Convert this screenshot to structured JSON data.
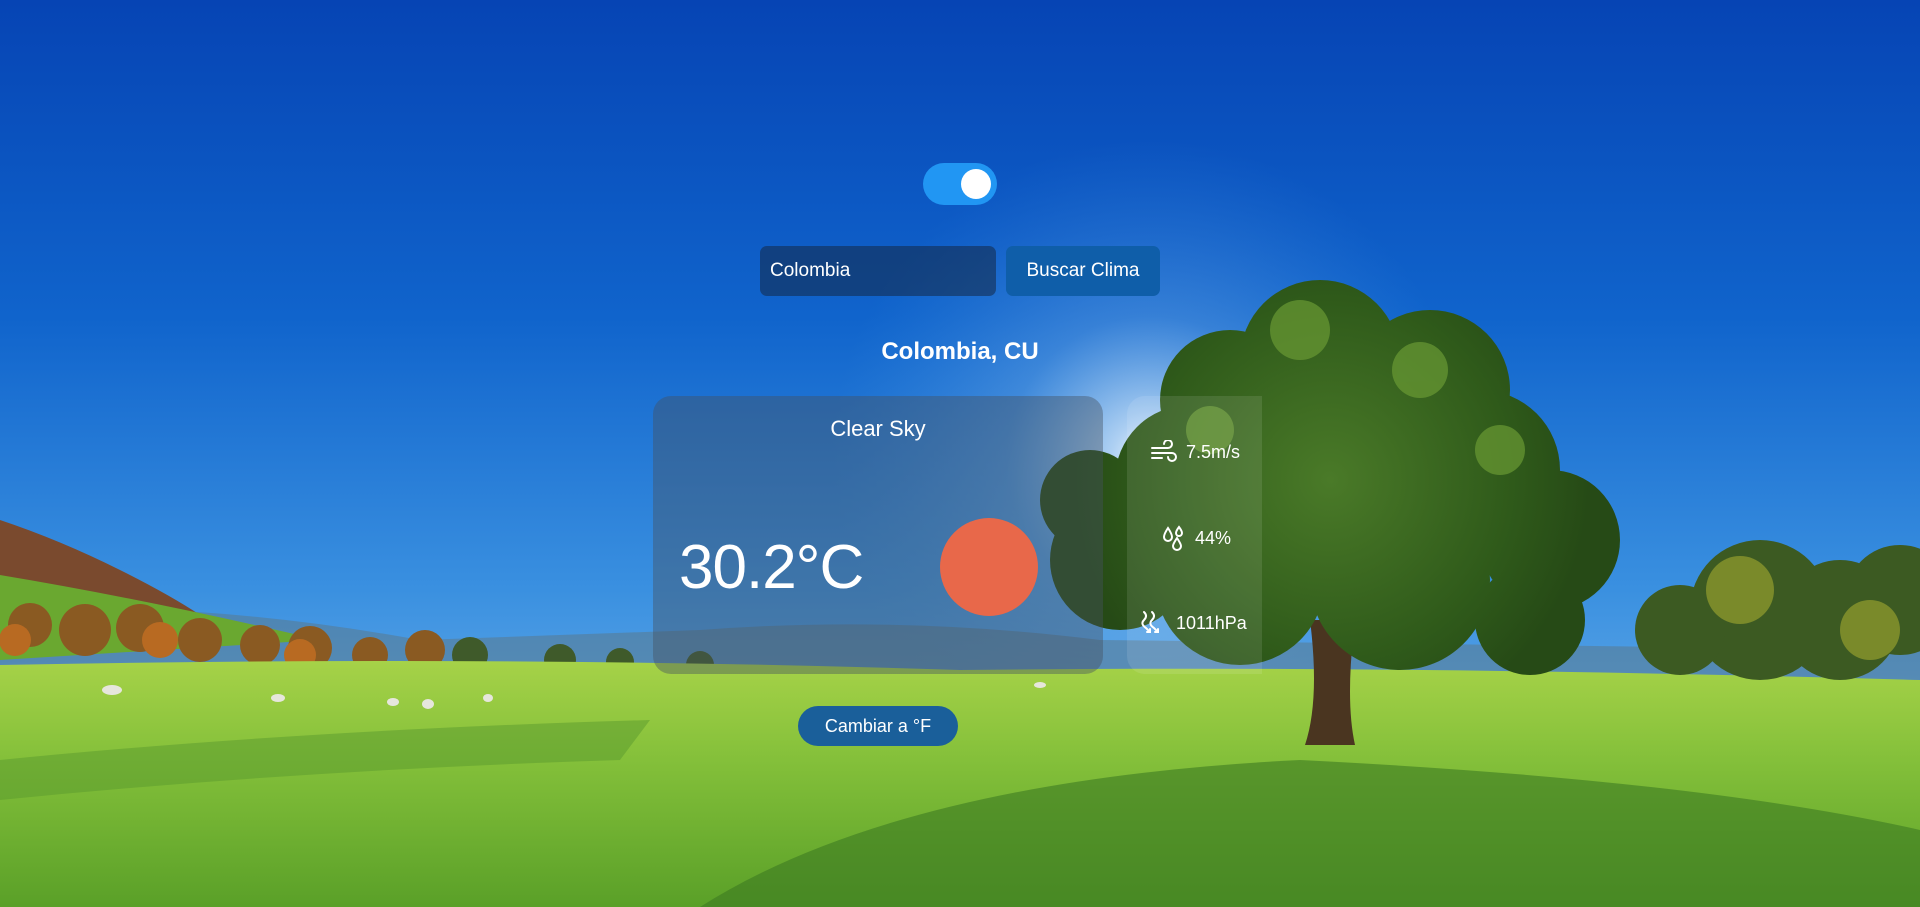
{
  "theme_toggle": {
    "state": "on",
    "color": "#2196f3"
  },
  "search": {
    "value": "Colombia",
    "button_label": "Buscar Clima"
  },
  "location": "Colombia, CU",
  "weather": {
    "description": "Clear Sky",
    "temperature": "30.2°C",
    "icon": "sun-icon",
    "icon_color": "#e8684a"
  },
  "stats": {
    "wind": {
      "icon": "wind-icon",
      "value": "7.5m/s"
    },
    "humidity": {
      "icon": "humidity-icon",
      "value": "44%"
    },
    "pressure": {
      "icon": "pressure-icon",
      "value": "1011hPa"
    }
  },
  "unit_button": {
    "label": "Cambiar a °F"
  },
  "colors": {
    "sky_top": "#0a48b8",
    "sky_bottom": "#6eb4ee",
    "grass": "#8cc43a",
    "button": "#0f5ea9"
  }
}
